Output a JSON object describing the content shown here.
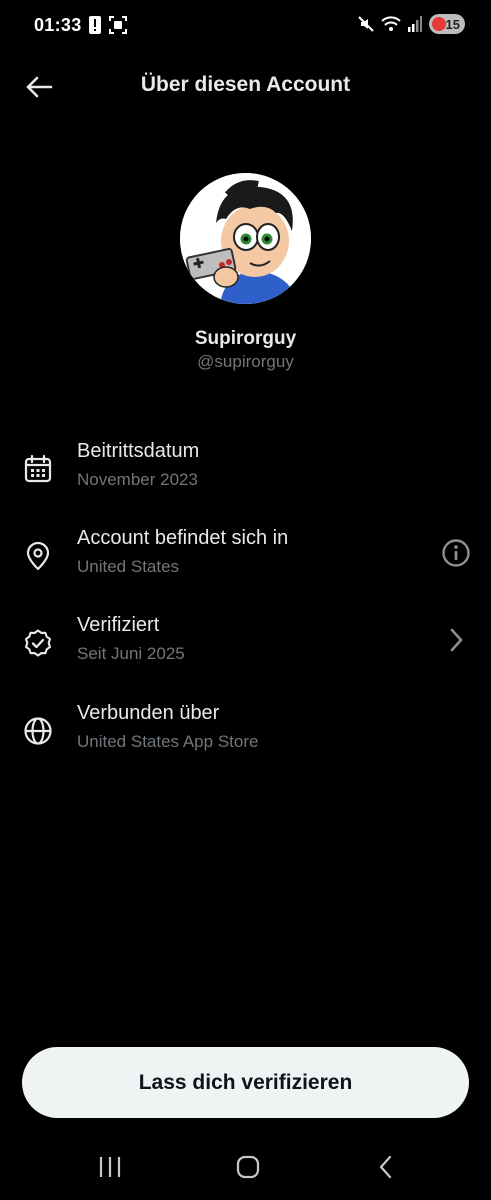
{
  "status_bar": {
    "time": "01:33",
    "battery": "15",
    "icons": [
      "alert-icon",
      "screenshot-icon",
      "mute-icon",
      "wifi-icon",
      "signal-icon",
      "battery-icon"
    ]
  },
  "header": {
    "title": "Über diesen Account",
    "back_icon": "arrow-left-icon"
  },
  "profile": {
    "name": "Supirorguy",
    "handle": "@supirorguy"
  },
  "info": {
    "items": [
      {
        "title": "Beitrittsdatum",
        "subtitle": "November 2023",
        "icon": "calendar-icon"
      },
      {
        "title": "Account befindet sich in",
        "subtitle": "United States",
        "icon": "location-pin-icon",
        "action_icon": "info-icon"
      },
      {
        "title": "Verifiziert",
        "subtitle": "Seit Juni 2025",
        "icon": "verified-badge-icon",
        "action_icon": "chevron-right-icon"
      },
      {
        "title": "Verbunden über",
        "subtitle": "United States App Store",
        "icon": "globe-icon"
      }
    ]
  },
  "cta": {
    "label": "Lass dich verifizieren"
  },
  "nav": {
    "icons": [
      "recent-apps-icon",
      "home-icon",
      "back-icon"
    ]
  },
  "colors": {
    "background": "#000000",
    "text": "#e7e9ea",
    "muted": "#71767b",
    "button_bg": "#eff3f4"
  }
}
